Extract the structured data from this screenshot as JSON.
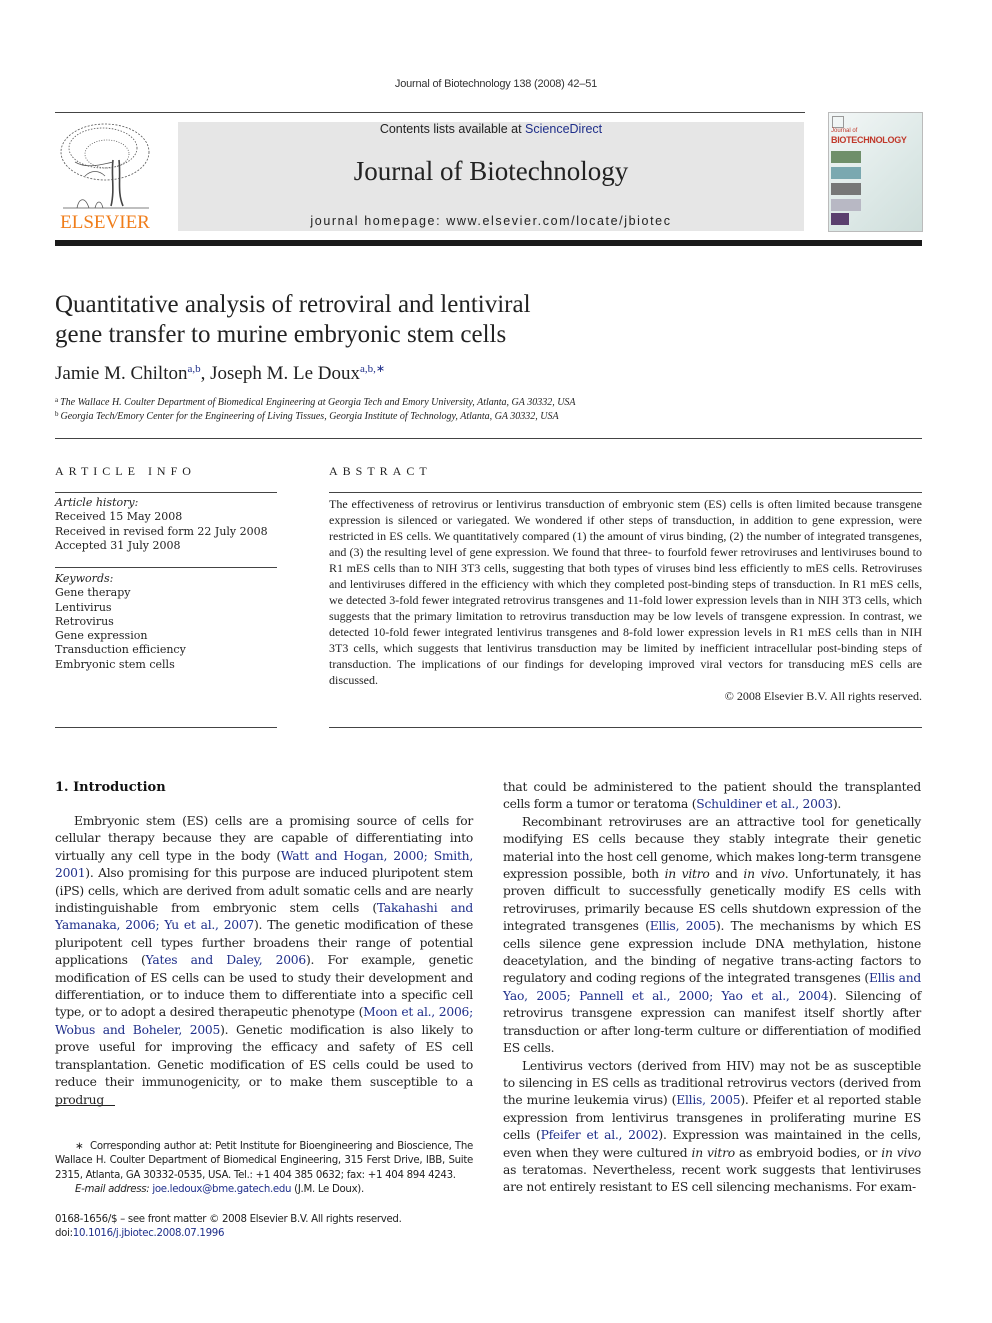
{
  "running_head": "Journal of Biotechnology 138 (2008) 42–51",
  "masthead": {
    "publisher_logo_text": "ELSEVIER",
    "contents_prefix": "Contents lists available at ",
    "contents_link": "ScienceDirect",
    "journal_name": "Journal of Biotechnology",
    "homepage": "journal homepage: www.elsevier.com/locate/jbiotec",
    "cover_title_small": "Journal of",
    "cover_title_large": "BIOTECHNOLOGY",
    "brand_color": "#f07d1a",
    "link_color": "#1f2f8a"
  },
  "article": {
    "title_line1": "Quantitative analysis of retroviral and lentiviral",
    "title_line2": "gene transfer to murine embryonic stem cells",
    "authors": [
      {
        "name": "Jamie M. Chilton",
        "marks": "a,b"
      },
      {
        "name": "Joseph M. Le Doux",
        "marks": "a,b,∗"
      }
    ],
    "author_separator": ", ",
    "affiliations": [
      {
        "mark": "a",
        "text": "The Wallace H. Coulter Department of Biomedical Engineering at Georgia Tech and Emory University, Atlanta, GA 30332, USA"
      },
      {
        "mark": "b",
        "text": "Georgia Tech/Emory Center for the Engineering of Living Tissues, Georgia Institute of Technology, Atlanta, GA 30332, USA"
      }
    ]
  },
  "article_info": {
    "heading": "ARTICLE INFO",
    "history_label": "Article history:",
    "history": [
      "Received 15 May 2008",
      "Received in revised form 22 July 2008",
      "Accepted 31 July 2008"
    ],
    "keywords_label": "Keywords:",
    "keywords": [
      "Gene therapy",
      "Lentivirus",
      "Retrovirus",
      "Gene expression",
      "Transduction efficiency",
      "Embryonic stem cells"
    ]
  },
  "abstract": {
    "heading": "ABSTRACT",
    "text": "The effectiveness of retrovirus or lentivirus transduction of embryonic stem (ES) cells is often limited because transgene expression is silenced or variegated. We wondered if other steps of transduction, in addition to gene expression, were restricted in ES cells. We quantitatively compared (1) the amount of virus binding, (2) the number of integrated transgenes, and (3) the resulting level of gene expression. We found that three- to fourfold fewer retroviruses and lentiviruses bound to R1 mES cells than to NIH 3T3 cells, suggesting that both types of viruses bind less efficiently to mES cells. Retroviruses and lentiviruses differed in the efficiency with which they completed post-binding steps of transduction. In R1 mES cells, we detected 3-fold fewer integrated retrovirus transgenes and 11-fold lower expression levels than in NIH 3T3 cells, which suggests that the primary limitation to retrovirus transduction may be low levels of transgene expression. In contrast, we detected 10-fold fewer integrated lentivirus transgenes and 8-fold lower expression levels in R1 mES cells than in NIH 3T3 cells, which suggests that lentivirus transduction may be limited by inefficient intracellular post-binding steps of transduction. The implications of our findings for developing improved viral vectors for transducing mES cells are discussed.",
    "copyright": "© 2008 Elsevier B.V. All rights reserved."
  },
  "introduction": {
    "heading": "1.  Introduction",
    "p1": [
      {
        "t": "Embryonic stem (ES) cells are a promising source of cells for cellular therapy because they are capable of differentiating into virtually any cell type in the body ("
      },
      {
        "c": "Watt and Hogan, 2000; Smith, 2001"
      },
      {
        "t": "). Also promising for this purpose are induced pluripotent stem (iPS) cells, which are derived from adult somatic cells and are nearly indistinguishable from embryonic stem cells ("
      },
      {
        "c": "Takahashi and Yamanaka, 2006; Yu et al., 2007"
      },
      {
        "t": "). The genetic modification of these pluripotent cell types further broadens their range of potential applications ("
      },
      {
        "c": "Yates and Daley, 2006"
      },
      {
        "t": "). For example, genetic modification of ES cells can be used to study their development and differentiation, or to induce them to differentiate into a specific cell type, or to adopt a desired therapeutic phenotype ("
      },
      {
        "c": "Moon et al., 2006; Wobus and Boheler, 2005"
      },
      {
        "t": "). Genetic modification is also likely to prove useful for improving the efficacy and safety of ES cell transplantation. Genetic modification of ES cells could be used to reduce their immunogenicity, or to make them susceptible to a prodrug that could be administered to the patient should the transplanted cells form a tumor or teratoma ("
      },
      {
        "c": "Schuldiner et al., 2003"
      },
      {
        "t": ")."
      }
    ],
    "p1_right_start": [
      {
        "t": "that could be administered to the patient should the transplanted cells form a tumor or teratoma ("
      },
      {
        "c": "Schuldiner et al., 2003"
      },
      {
        "t": ")."
      }
    ],
    "p1_left_part": [
      {
        "t": "Embryonic stem (ES) cells are a promising source of cells for cellular therapy because they are capable of differentiating into virtually any cell type in the body ("
      },
      {
        "c": "Watt and Hogan, 2000; Smith, 2001"
      },
      {
        "t": "). Also promising for this purpose are induced pluripotent stem (iPS) cells, which are derived from adult somatic cells and are nearly indistinguishable from embryonic stem cells ("
      },
      {
        "c": "Takahashi and Yamanaka, 2006; Yu et al., 2007"
      },
      {
        "t": "). The genetic modification of these pluripotent cell types further broadens their range of potential applications ("
      },
      {
        "c": "Yates and Daley, 2006"
      },
      {
        "t": "). For example, genetic modification of ES cells can be used to study their development and differentiation, or to induce them to differentiate into a specific cell type, or to adopt a desired therapeutic phenotype ("
      },
      {
        "c": "Moon et al., 2006; Wobus and Boheler, 2005"
      },
      {
        "t": "). Genetic modification is also likely to prove useful for improving the efficacy and safety of ES cell transplantation. Genetic modification of ES cells could be used to reduce their immunogenicity, or to make them susceptible to a prodrug"
      }
    ],
    "p2": [
      {
        "t": "Recombinant retroviruses are an attractive tool for genetically modifying ES cells because they stably integrate their genetic material into the host cell genome, which makes long-term transgene expression possible, both "
      },
      {
        "i": "in vitro"
      },
      {
        "t": " and "
      },
      {
        "i": "in vivo"
      },
      {
        "t": ". Unfortunately, it has proven difficult to successfully genetically modify ES cells with retroviruses, primarily because ES cells shutdown expression of the integrated transgenes ("
      },
      {
        "c": "Ellis, 2005"
      },
      {
        "t": "). The mechanisms by which ES cells silence gene expression include DNA methylation, histone deacetylation, and the binding of negative trans-acting factors to regulatory and coding regions of the integrated transgenes ("
      },
      {
        "c": "Ellis and Yao, 2005; Pannell et al., 2000; Yao et al., 2004"
      },
      {
        "t": "). Silencing of retrovirus transgene expression can manifest itself shortly after transduction or after long-term culture or differentiation of modified ES cells."
      }
    ],
    "p3": [
      {
        "t": "Lentivirus vectors (derived from HIV) may not be as susceptible to silencing in ES cells as traditional retrovirus vectors (derived from the murine leukemia virus) ("
      },
      {
        "c": "Ellis, 2005"
      },
      {
        "t": "). Pfeifer et al reported stable expression from lentivirus transgenes in proliferating murine ES cells ("
      },
      {
        "c": "Pfeifer et al., 2002"
      },
      {
        "t": "). Expression was maintained in the cells, even when they were cultured "
      },
      {
        "i": "in vitro"
      },
      {
        "t": " as embryoid bodies, or "
      },
      {
        "i": "in vivo"
      },
      {
        "t": " as teratomas. Nevertheless, recent work suggests that lentiviruses are not entirely resistant to ES cell silencing mechanisms. For exam-"
      }
    ]
  },
  "footnote": {
    "corresponding_mark": "∗",
    "corresponding_text": "Corresponding author at: Petit Institute for Bioengineering and Bioscience, The Wallace H. Coulter Department of Biomedical Engineering, 315 Ferst Drive, IBB, Suite 2315, Atlanta, GA 30332-0535, USA. Tel.: +1 404 385 0632; fax: +1 404 894 4243.",
    "email_label": "E-mail address:",
    "email": "joe.ledoux@bme.gatech.edu",
    "email_owner": " (J.M. Le Doux)."
  },
  "front_matter": {
    "issn_line": "0168-1656/$ – see front matter © 2008 Elsevier B.V. All rights reserved.",
    "doi_prefix": "doi:",
    "doi": "10.1016/j.jbiotec.2008.07.1996"
  }
}
